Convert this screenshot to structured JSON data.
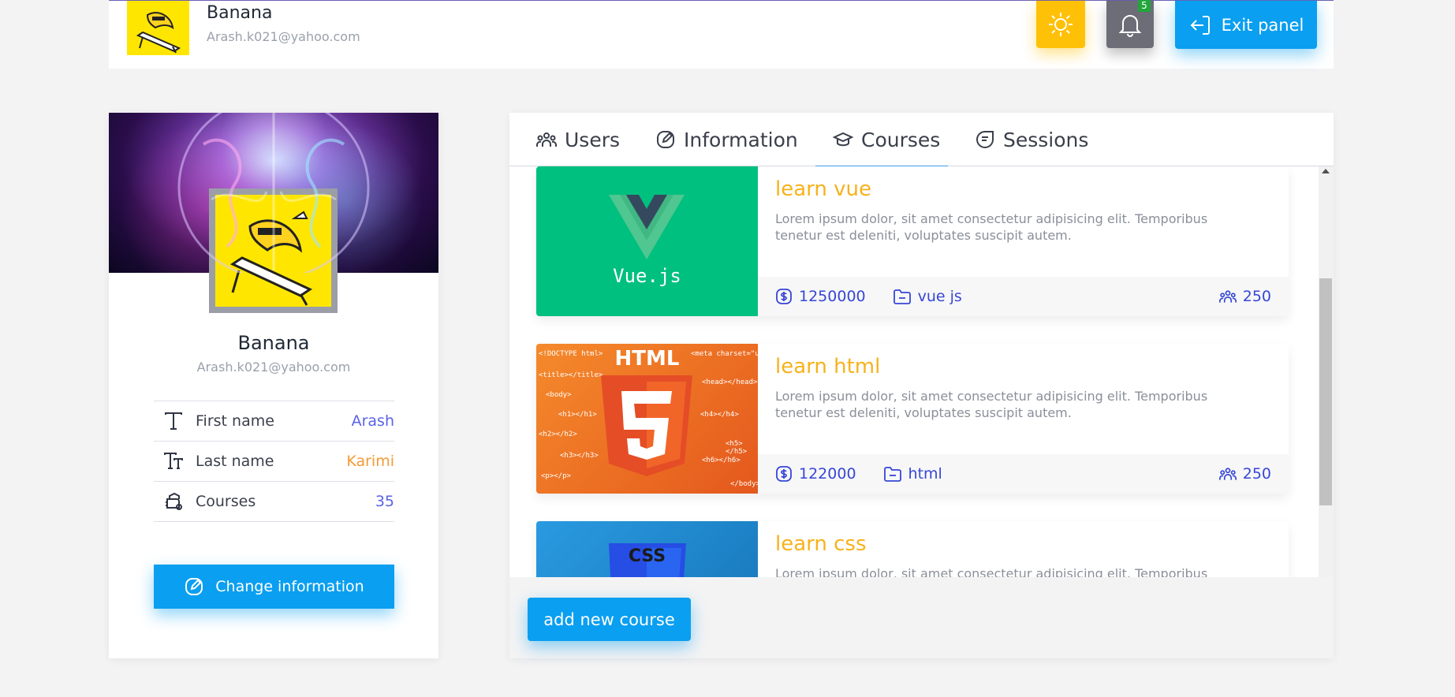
{
  "header": {
    "user_name": "Banana",
    "user_email": "Arash.k021@yahoo.com",
    "notification_count": "5",
    "exit_label": "Exit panel"
  },
  "profile": {
    "name": "Banana",
    "email": "Arash.k021@yahoo.com",
    "rows": [
      {
        "label": "First name",
        "value": "Arash",
        "color": "#5a63e6"
      },
      {
        "label": "Last name",
        "value": "Karimi",
        "color": "#f59a35"
      },
      {
        "label": "Courses",
        "value": "35",
        "color": "#5a63e6"
      }
    ],
    "change_label": "Change information"
  },
  "tabs": [
    {
      "label": "Users",
      "icon": "users-icon"
    },
    {
      "label": "Information",
      "icon": "edit-icon"
    },
    {
      "label": "Courses",
      "icon": "graduation-cap-icon",
      "active": true
    },
    {
      "label": "Sessions",
      "icon": "sessions-icon"
    }
  ],
  "courses": [
    {
      "title": "learn vue",
      "description": "Lorem ipsum dolor, sit amet consectetur adipisicing elit. Temporibus tenetur est deleniti, voluptates suscipit autem.",
      "price": "1250000",
      "category": "vue js",
      "students": "250",
      "thumb_label": "Vue.js",
      "thumb_color": "#00c07f"
    },
    {
      "title": "learn html",
      "description": "Lorem ipsum dolor, sit amet consectetur adipisicing elit. Temporibus tenetur est deleniti, voluptates suscipit autem.",
      "price": "122000",
      "category": "html",
      "students": "250",
      "thumb_label": "HTML",
      "thumb_color": "#f07b24",
      "code_snippets": [
        "<!DOCTYPE html>",
        "<meta charset=\"utf-",
        "<title></title>",
        "<head></head>",
        "<body>",
        "<h1></h1>",
        "<h4></h4>",
        "<h2></h2>",
        "<h5></h5>",
        "<h3></h3>",
        "<h6></h6>",
        "<p></p>",
        "</body>"
      ]
    },
    {
      "title": "learn css",
      "description": "Lorem ipsum dolor, sit amet consectetur adipisicing elit. Temporibus",
      "thumb_label": "CSS",
      "thumb_color": "#1e88d4"
    }
  ],
  "add_course_label": "add new course"
}
